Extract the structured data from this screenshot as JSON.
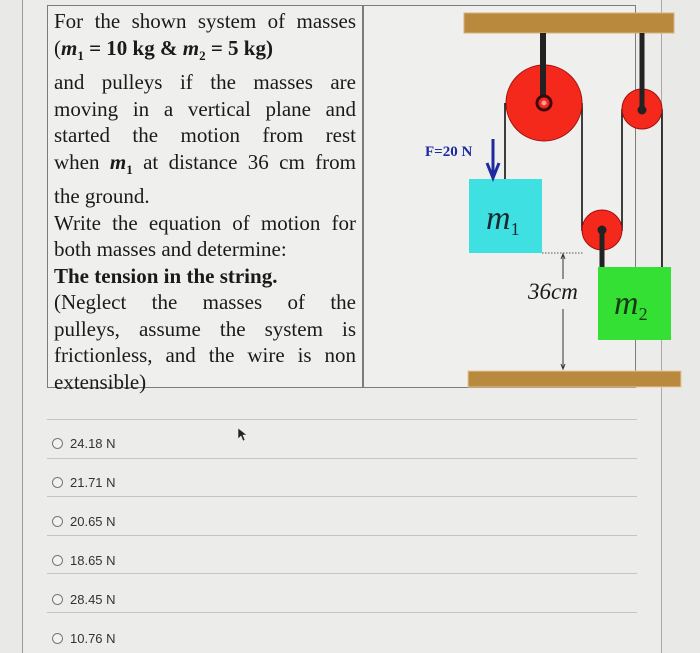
{
  "question": {
    "lines": [
      {
        "text": "For the shown system of masses"
      },
      {
        "math_line": true,
        "m1_label": "m",
        "m1_sub": "1",
        "m1_value": " = 10 kg & ",
        "m2_label": "m",
        "m2_sub": "2",
        "m2_value": " = 5 kg)",
        "open_paren": "("
      },
      {
        "text": "and pulleys if the masses are"
      },
      {
        "text": "moving in a vertical plane and"
      },
      {
        "text": "started the motion from rest"
      },
      {
        "inline_math": true,
        "before": "when ",
        "m_label": "m",
        "m_sub": "1",
        "after": " at distance 36 cm from"
      },
      {
        "text": "the ground.",
        "last": true
      },
      {
        "text": "Write the equation of motion for"
      },
      {
        "text": "both masses and determine:",
        "last": true
      },
      {
        "text": "The tension in the string.",
        "bold": true,
        "last": true
      },
      {
        "text": "(Neglect the masses of the"
      },
      {
        "text": "pulleys, assume the system is"
      },
      {
        "text": "frictionless, and the wire is non"
      },
      {
        "text": "extensible)",
        "last": true
      }
    ]
  },
  "diagram": {
    "force_label": "F=20 N",
    "m1_label": "m",
    "m1_sub": "1",
    "m2_label": "m",
    "m2_sub": "2",
    "distance_label": "36cm",
    "colors": {
      "ceiling": "#b98a3e",
      "pulley": "#f5291b",
      "m1_block": "#3fe0e2",
      "m2_block": "#33e033",
      "force_arrow": "#1e2aa0",
      "rope": "#111111"
    }
  },
  "options": [
    {
      "label": "24.18 N",
      "selected": false
    },
    {
      "label": "21.71 N",
      "selected": false
    },
    {
      "label": "20.65 N",
      "selected": false
    },
    {
      "label": "18.65 N",
      "selected": false
    },
    {
      "label": "28.45 N",
      "selected": false
    },
    {
      "label": "10.76 N",
      "selected": false
    }
  ]
}
